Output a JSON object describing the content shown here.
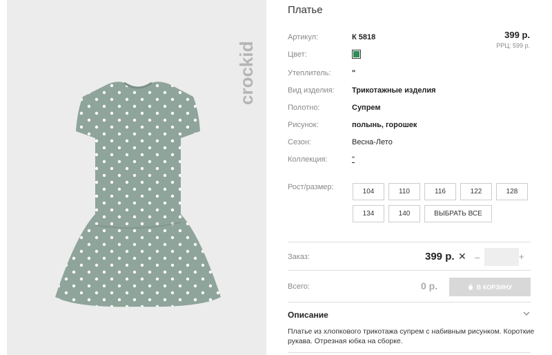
{
  "product": {
    "title": "Платье",
    "price": "399 р.",
    "rrp": "РРЦ: 599 р.",
    "brand": "crockid"
  },
  "attributes": [
    {
      "label": "Артикул:",
      "value": "К 5818"
    },
    {
      "label": "Цвет:",
      "value": ""
    },
    {
      "label": "Утеплитель:",
      "value": "\""
    },
    {
      "label": "Вид изделия:",
      "value": "Трикотажные изделия"
    },
    {
      "label": "Полотно:",
      "value": "Супрем"
    },
    {
      "label": "Рисунок:",
      "value": "полынь, горошек"
    },
    {
      "label": "Сезон:",
      "value": "Весна-Лето"
    },
    {
      "label": "Коллекция:",
      "value": "\""
    }
  ],
  "colors": {
    "swatch": "#2e8b57",
    "dress": "#8fa49a",
    "cart_button": "#d8d8d8"
  },
  "sizes": {
    "label": "Рост/размер:",
    "options": [
      "104",
      "110",
      "116",
      "122",
      "128",
      "134",
      "140"
    ],
    "select_all": "ВЫБРАТЬ ВСЕ"
  },
  "order": {
    "label": "Заказ:",
    "price": "399 р.",
    "times": "✕",
    "minus": "–",
    "plus": "+",
    "quantity": ""
  },
  "total": {
    "label": "Всего:",
    "value": "0 р.",
    "cart_button": "В КОРЗИНУ"
  },
  "description": {
    "title": "Описание",
    "text": "Платье из хлопкового трикотажа супрем с набивным рисунком. Короткие рукава. Отрезная юбка на сборке."
  }
}
